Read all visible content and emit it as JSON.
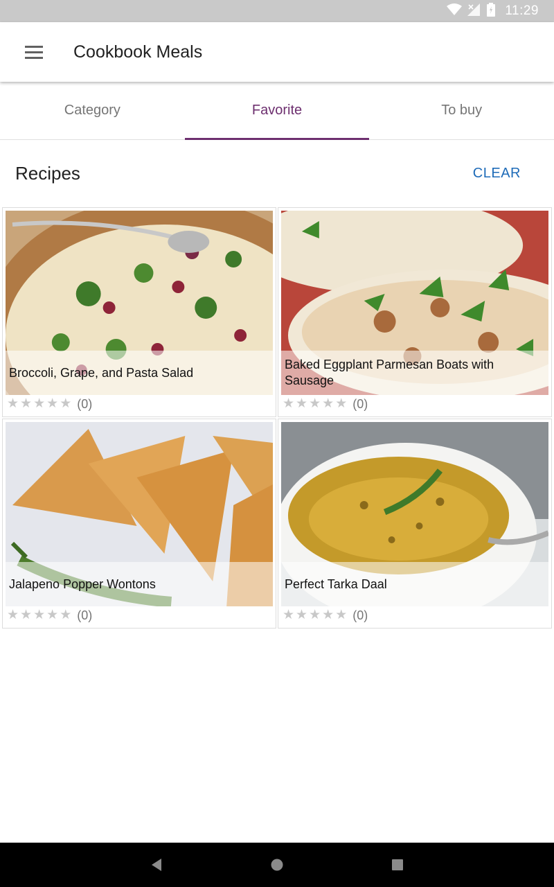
{
  "status_bar": {
    "time": "11:29"
  },
  "app": {
    "title": "Cookbook Meals"
  },
  "tabs": [
    {
      "label": "Category",
      "active": false
    },
    {
      "label": "Favorite",
      "active": true
    },
    {
      "label": "To buy",
      "active": false
    }
  ],
  "section": {
    "title": "Recipes",
    "clear_label": "CLEAR"
  },
  "recipes": [
    {
      "title": "Broccoli, Grape, and Pasta Salad",
      "rating_count": "(0)",
      "stars": 0
    },
    {
      "title": "Baked Eggplant Parmesan Boats with Sausage",
      "rating_count": "(0)",
      "stars": 0
    },
    {
      "title": "Jalapeno Popper Wontons",
      "rating_count": "(0)",
      "stars": 0
    },
    {
      "title": "Perfect Tarka Daal",
      "rating_count": "(0)",
      "stars": 0
    }
  ],
  "colors": {
    "accent": "#6d2f6f",
    "link": "#1e6bb8",
    "status_bar": "#c9c9c9"
  },
  "icons": [
    "wifi-icon",
    "signal-icon",
    "battery-icon",
    "menu-icon",
    "star-icon",
    "back-icon",
    "home-icon",
    "recents-icon"
  ]
}
